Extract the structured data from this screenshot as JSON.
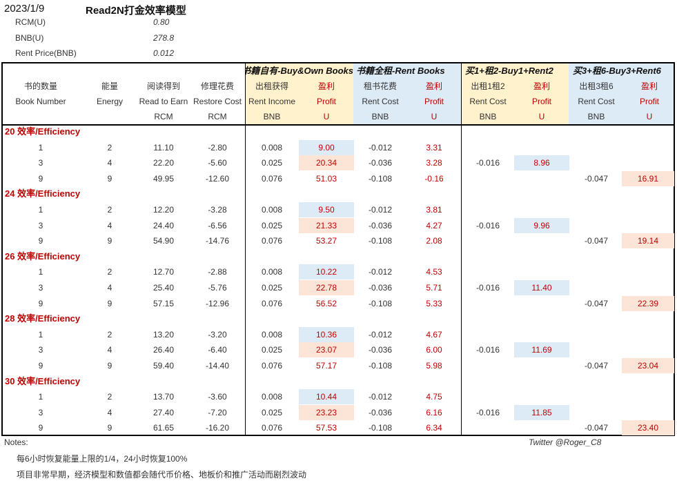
{
  "header": {
    "date": "2023/1/9",
    "title": "Read2N打金效率模型"
  },
  "params": [
    {
      "label": "RCM(U)",
      "value": "0.80"
    },
    {
      "label": "BNB(U)",
      "value": "278.8"
    },
    {
      "label": "Rent Price(BNB)",
      "value": "0.012"
    }
  ],
  "groups": {
    "buy_own": "书籍自有-Buy&Own Books",
    "rent_books": "书籍全租-Rent Books",
    "buy1_rent2": "买1+租2-Buy1+Rent2",
    "buy3_rent6": "买3+租6-Buy3+Rent6"
  },
  "columns": [
    {
      "cn": "书的数量",
      "en": "Book Number",
      "unit": ""
    },
    {
      "cn": "能量",
      "en": "Energy",
      "unit": ""
    },
    {
      "cn": "阅读得到",
      "en": "Read to Earn",
      "unit": "RCM"
    },
    {
      "cn": "修理花费",
      "en": "Restore Cost",
      "unit": "RCM"
    },
    {
      "cn": "出租获得",
      "en": "Rent Income",
      "unit": "BNB"
    },
    {
      "cn": "盈利",
      "en": "Profit",
      "unit": "U"
    },
    {
      "cn": "租书花费",
      "en": "Rent Cost",
      "unit": "BNB"
    },
    {
      "cn": "盈利",
      "en": "Profit",
      "unit": "U"
    },
    {
      "cn": "出租1租2",
      "en": "Rent Cost",
      "unit": "BNB"
    },
    {
      "cn": "盈利",
      "en": "Profit",
      "unit": "U"
    },
    {
      "cn": "出租3租6",
      "en": "Rent Cost",
      "unit": "BNB"
    },
    {
      "cn": "盈利",
      "en": "Profit",
      "unit": "U"
    }
  ],
  "sections": [
    {
      "title": "20 效率/Efficiency",
      "rows": [
        {
          "books": "1",
          "energy": "2",
          "read": "11.10",
          "restore": "-2.80",
          "rent_income": "0.008",
          "own_profit": "9.00",
          "rent_cost": "-0.012",
          "rent_profit": "3.31",
          "b1r2_cost": "",
          "b1r2_profit": "",
          "b3r6_cost": "",
          "b3r6_profit": ""
        },
        {
          "books": "3",
          "energy": "4",
          "read": "22.20",
          "restore": "-5.60",
          "rent_income": "0.025",
          "own_profit": "20.34",
          "rent_cost": "-0.036",
          "rent_profit": "3.28",
          "b1r2_cost": "-0.016",
          "b1r2_profit": "8.96",
          "b3r6_cost": "",
          "b3r6_profit": ""
        },
        {
          "books": "9",
          "energy": "9",
          "read": "49.95",
          "restore": "-12.60",
          "rent_income": "0.076",
          "own_profit": "51.03",
          "rent_cost": "-0.108",
          "rent_profit": "-0.16",
          "b1r2_cost": "",
          "b1r2_profit": "",
          "b3r6_cost": "-0.047",
          "b3r6_profit": "16.91"
        }
      ]
    },
    {
      "title": "24 效率/Efficiency",
      "rows": [
        {
          "books": "1",
          "energy": "2",
          "read": "12.20",
          "restore": "-3.28",
          "rent_income": "0.008",
          "own_profit": "9.50",
          "rent_cost": "-0.012",
          "rent_profit": "3.81",
          "b1r2_cost": "",
          "b1r2_profit": "",
          "b3r6_cost": "",
          "b3r6_profit": ""
        },
        {
          "books": "3",
          "energy": "4",
          "read": "24.40",
          "restore": "-6.56",
          "rent_income": "0.025",
          "own_profit": "21.33",
          "rent_cost": "-0.036",
          "rent_profit": "4.27",
          "b1r2_cost": "-0.016",
          "b1r2_profit": "9.96",
          "b3r6_cost": "",
          "b3r6_profit": ""
        },
        {
          "books": "9",
          "energy": "9",
          "read": "54.90",
          "restore": "-14.76",
          "rent_income": "0.076",
          "own_profit": "53.27",
          "rent_cost": "-0.108",
          "rent_profit": "2.08",
          "b1r2_cost": "",
          "b1r2_profit": "",
          "b3r6_cost": "-0.047",
          "b3r6_profit": "19.14"
        }
      ]
    },
    {
      "title": "26 效率/Efficiency",
      "rows": [
        {
          "books": "1",
          "energy": "2",
          "read": "12.70",
          "restore": "-2.88",
          "rent_income": "0.008",
          "own_profit": "10.22",
          "rent_cost": "-0.012",
          "rent_profit": "4.53",
          "b1r2_cost": "",
          "b1r2_profit": "",
          "b3r6_cost": "",
          "b3r6_profit": ""
        },
        {
          "books": "3",
          "energy": "4",
          "read": "25.40",
          "restore": "-5.76",
          "rent_income": "0.025",
          "own_profit": "22.78",
          "rent_cost": "-0.036",
          "rent_profit": "5.71",
          "b1r2_cost": "-0.016",
          "b1r2_profit": "11.40",
          "b3r6_cost": "",
          "b3r6_profit": ""
        },
        {
          "books": "9",
          "energy": "9",
          "read": "57.15",
          "restore": "-12.96",
          "rent_income": "0.076",
          "own_profit": "56.52",
          "rent_cost": "-0.108",
          "rent_profit": "5.33",
          "b1r2_cost": "",
          "b1r2_profit": "",
          "b3r6_cost": "-0.047",
          "b3r6_profit": "22.39"
        }
      ]
    },
    {
      "title": "28 效率/Efficiency",
      "rows": [
        {
          "books": "1",
          "energy": "2",
          "read": "13.20",
          "restore": "-3.20",
          "rent_income": "0.008",
          "own_profit": "10.36",
          "rent_cost": "-0.012",
          "rent_profit": "4.67",
          "b1r2_cost": "",
          "b1r2_profit": "",
          "b3r6_cost": "",
          "b3r6_profit": ""
        },
        {
          "books": "3",
          "energy": "4",
          "read": "26.40",
          "restore": "-6.40",
          "rent_income": "0.025",
          "own_profit": "23.07",
          "rent_cost": "-0.036",
          "rent_profit": "6.00",
          "b1r2_cost": "-0.016",
          "b1r2_profit": "11.69",
          "b3r6_cost": "",
          "b3r6_profit": ""
        },
        {
          "books": "9",
          "energy": "9",
          "read": "59.40",
          "restore": "-14.40",
          "rent_income": "0.076",
          "own_profit": "57.17",
          "rent_cost": "-0.108",
          "rent_profit": "5.98",
          "b1r2_cost": "",
          "b1r2_profit": "",
          "b3r6_cost": "-0.047",
          "b3r6_profit": "23.04"
        }
      ]
    },
    {
      "title": "30 效率/Efficiency",
      "rows": [
        {
          "books": "1",
          "energy": "2",
          "read": "13.70",
          "restore": "-3.60",
          "rent_income": "0.008",
          "own_profit": "10.44",
          "rent_cost": "-0.012",
          "rent_profit": "4.75",
          "b1r2_cost": "",
          "b1r2_profit": "",
          "b3r6_cost": "",
          "b3r6_profit": ""
        },
        {
          "books": "3",
          "energy": "4",
          "read": "27.40",
          "restore": "-7.20",
          "rent_income": "0.025",
          "own_profit": "23.23",
          "rent_cost": "-0.036",
          "rent_profit": "6.16",
          "b1r2_cost": "-0.016",
          "b1r2_profit": "11.85",
          "b3r6_cost": "",
          "b3r6_profit": ""
        },
        {
          "books": "9",
          "energy": "9",
          "read": "61.65",
          "restore": "-16.20",
          "rent_income": "0.076",
          "own_profit": "57.53",
          "rent_cost": "-0.108",
          "rent_profit": "6.34",
          "b1r2_cost": "",
          "b1r2_profit": "",
          "b3r6_cost": "-0.047",
          "b3r6_profit": "23.40"
        }
      ]
    }
  ],
  "highlights": {
    "blue": "#ddebf7",
    "red": "#fce4d6",
    "yellow_band": "#fff2cc",
    "accent_red": "#c00000"
  },
  "notes": {
    "label": "Notes:",
    "lines": [
      "每6小时恢复能量上限的1/4，24小时恢复100%",
      "项目非常早期，经济模型和数值都会随代币价格、地板价和推广活动而剧烈波动"
    ],
    "credit": "Twitter @Roger_C8"
  }
}
